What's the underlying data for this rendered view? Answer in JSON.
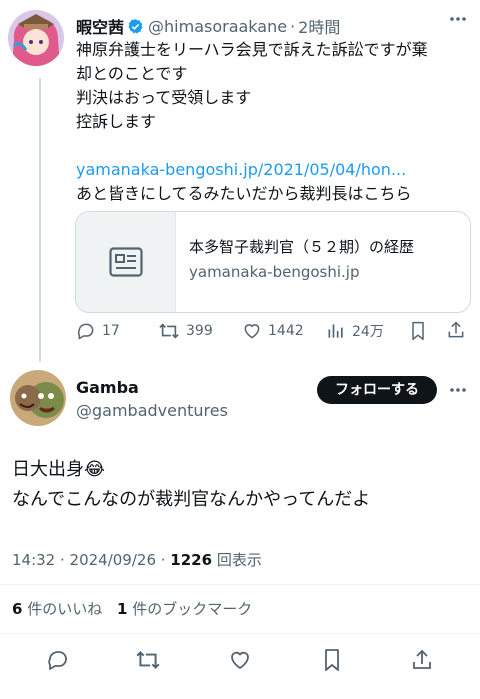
{
  "parent_tweet": {
    "display_name": "暇空茜",
    "handle": "@himasoraakane",
    "time": "2時間",
    "lines": [
      "神原弁護士をリーハラ会見で訴えた訴訟ですが棄",
      "却とのことです",
      "判決はおって受領します",
      "控訴します"
    ],
    "link_text": "yamanaka-bengoshi.jp/2021/05/04/hon...",
    "after_link": "あと皆きにしてるみたいだから裁判長はこちら",
    "card": {
      "title": "本多智子裁判官（５２期）の経歴",
      "domain": "yamanaka-bengoshi.jp"
    },
    "actions": {
      "replies": "17",
      "retweets": "399",
      "likes": "1442",
      "views": "24万"
    }
  },
  "main_tweet": {
    "display_name": "Gamba",
    "handle": "@gambadventures",
    "follow_label": "フォローする",
    "line1": "日大出身😂",
    "line2": "なんでこんなのが裁判官なんかやってんだよ",
    "timestamp": "14:32 · 2024/09/26 · ",
    "view_count": "1226",
    "view_label": " 回表示",
    "likes_count": "6",
    "likes_label": " 件のいいね",
    "bookmarks_count": "1",
    "bookmarks_label": " 件のブックマーク"
  },
  "colors": {
    "accent": "#1d9bf0",
    "text": "#0f1419",
    "muted": "#536471",
    "border": "#cfd9de"
  }
}
